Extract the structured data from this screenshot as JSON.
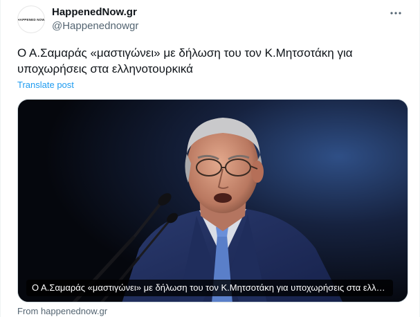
{
  "account": {
    "display_name": "HappenedNow.gr",
    "handle": "@Happenednowgr",
    "avatar_text": "HAPPENED NOW"
  },
  "tweet": {
    "text": "Ο Α.Σαμαράς «μαστιγώνει» με δήλωση του τον Κ.Μητσοτάκη για υποχωρήσεις στα ελληνοτουρκικά",
    "translate_label": "Translate post"
  },
  "card": {
    "caption": "Ο Α.Σαμαράς «μαστιγώνει» με δήλωση του τον Κ.Μητσοτάκη για υποχωρήσεις στα ελληνοτουρκικά",
    "source": "From happenednow.gr"
  },
  "icons": {
    "more": "more-horizontal-icon"
  },
  "colors": {
    "link": "#1d9bf0",
    "secondary_text": "#536471",
    "primary_text": "#0f1419"
  }
}
